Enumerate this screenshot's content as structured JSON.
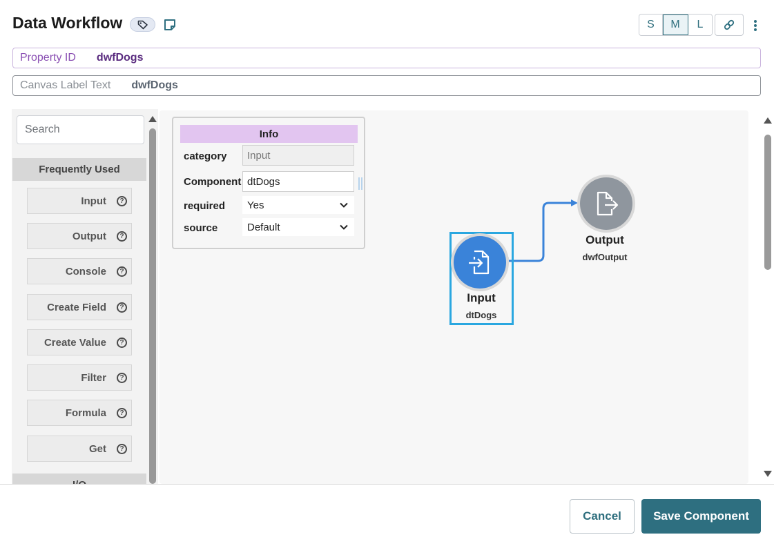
{
  "header": {
    "title": "Data Workflow",
    "sizes": [
      "S",
      "M",
      "L"
    ],
    "active_size": "M",
    "icons": [
      "tag-icon",
      "note-icon",
      "link-icon",
      "kebab-menu-icon"
    ]
  },
  "fields": {
    "property_id": {
      "label": "Property ID",
      "value": "dwfDogs"
    },
    "canvas_label": {
      "label": "Canvas Label Text",
      "value": "dwfDogs"
    }
  },
  "palette": {
    "search_placeholder": "Search",
    "section_frequently_used": "Frequently Used",
    "section_next": "I/O",
    "items": [
      "Input",
      "Output",
      "Console",
      "Create Field",
      "Create Value",
      "Filter",
      "Formula",
      "Get"
    ]
  },
  "info_panel": {
    "title": "Info",
    "rows": {
      "category": {
        "label": "category",
        "value": "Input"
      },
      "component": {
        "label": "Component",
        "value": "dtDogs"
      },
      "required": {
        "label": "required",
        "value": "Yes"
      },
      "source": {
        "label": "source",
        "value": "Default"
      }
    }
  },
  "nodes": {
    "input": {
      "title": "Input",
      "subtitle": "dtDogs",
      "color": "#3a83d9"
    },
    "output": {
      "title": "Output",
      "subtitle": "dwfOutput",
      "color": "#8f969e"
    }
  },
  "footer": {
    "cancel_label": "Cancel",
    "save_label": "Save Component"
  }
}
